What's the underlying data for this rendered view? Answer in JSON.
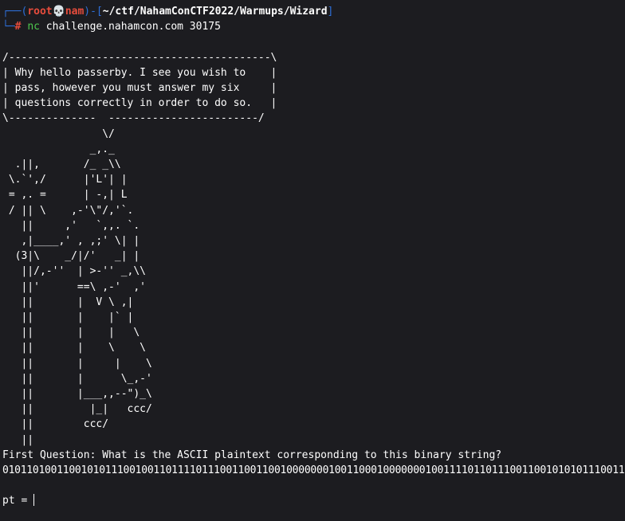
{
  "prompt": {
    "top_open": "┌──(",
    "user": "root",
    "skull": "💀",
    "host": "nam",
    "mid": ")-[",
    "cwd": "~/ctf/NahamConCTF2022/Warmups/Wizard",
    "top_close": "]",
    "bottom_frame": "└─",
    "hash": "#",
    "cmd": "nc",
    "args": " challenge.nahamcon.com 30175"
  },
  "ascii_art": "/------------------------------------------\\\n| Why hello passerby. I see you wish to    |\n| pass, however you must answer my six     |\n| questions correctly in order to do so.   |\n\\--------------  ------------------------/\n                \\/\n              _,._\n  .||,       /_ _\\\\\n \\.`',/      |'L'| |\n = ,. =      | -,| L\n / || \\    ,-'\\\"/,'`.\n   ||     ,'   `,,. `.\n   ,|____,' , ,;' \\| |\n  (3|\\    _/|/'   _| |\n   ||/,-''  | >-'' _,\\\\\n   ||'      ==\\ ,-'  ,'\n   ||       |  V \\ ,|\n   ||       |    |` |\n   ||       |    |   \\\n   ||       |    \\    \\\n   ||       |     |    \\\n   ||       |      \\_,-'\n   ||       |___,,--\")_\\\n   ||         |_|   ccc/\n   ||        ccc/\n   ||",
  "question": "First Question: What is the ASCII plaintext corresponding to this binary string?",
  "binary": "0101101001100101011100100110111101110011001100100000001001100010000000100111101101110011001010101110011",
  "input": {
    "label": "pt = ",
    "value": ""
  }
}
